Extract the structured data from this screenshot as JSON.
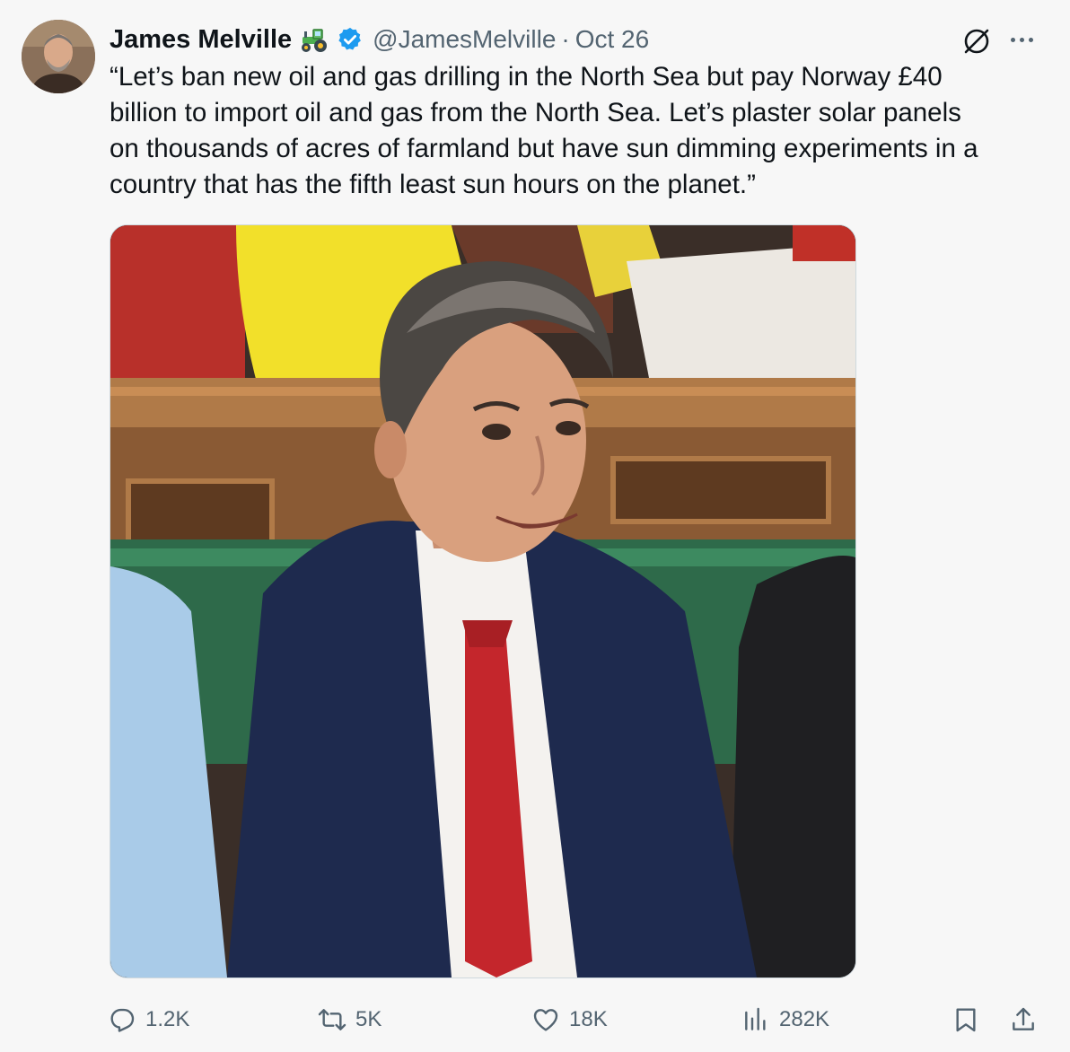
{
  "tweet": {
    "author_name": "James Melville",
    "author_handle": "@JamesMelville",
    "separator": "·",
    "date": "Oct 26",
    "text_lines": [
      "“Let’s ban new oil and gas drilling in the North Sea but pay Norway £40",
      "billion to import oil and gas from the North Sea. Let’s plaster solar panels",
      "on thousands of acres of farmland but have sun dimming experiments in a",
      "country that has the fifth least sun hours on the planet.”"
    ]
  },
  "badges": {
    "emoji_icon": "tractor-icon",
    "verified_icon": "verified-badge-icon",
    "verified_color": "#1d9bf0"
  },
  "stats": {
    "replies": "1.2K",
    "reposts": "5K",
    "likes": "18K",
    "views": "282K"
  },
  "colors": {
    "text": "#0f1419",
    "secondary": "#536471",
    "background": "#f7f7f7",
    "accent": "#1d9bf0"
  }
}
